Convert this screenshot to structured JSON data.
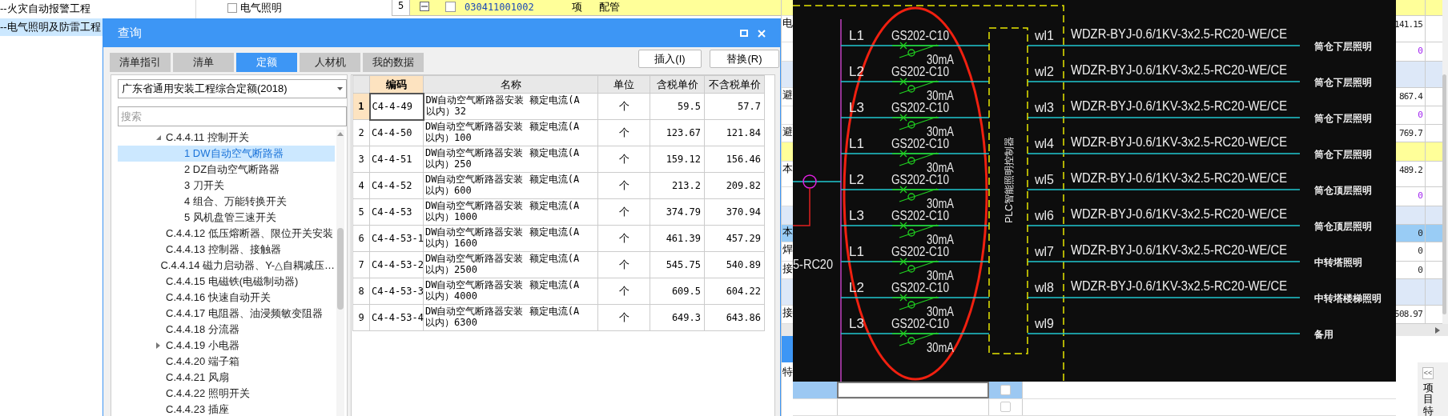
{
  "background_app": {
    "project_items": [
      {
        "label": "--火灾自动报警工程",
        "selected": false
      },
      {
        "label": "--电气照明及防雷工程",
        "selected": true
      }
    ],
    "top_checkbox": {
      "label": "电气照明",
      "checked": false
    },
    "top_row": {
      "index": "5",
      "collapsed": false,
      "checked": false,
      "code": "030411001002",
      "unit": "项",
      "name": "配管"
    },
    "rows": [
      {
        "kind": "yellow"
      },
      {
        "kind": "number",
        "edge_text": "电",
        "value": "141.15"
      },
      {
        "kind": "zero",
        "value": "0"
      },
      {
        "kind": "group"
      },
      {
        "kind": "number",
        "edge_text": "避",
        "value": "867.4"
      },
      {
        "kind": "zero",
        "value": "0"
      },
      {
        "kind": "number",
        "edge_text": "避",
        "value": "769.7"
      },
      {
        "kind": "yellow"
      },
      {
        "kind": "number",
        "edge_text": "本",
        "value": "489.2"
      },
      {
        "kind": "zero",
        "value": "0"
      },
      {
        "kind": "group"
      },
      {
        "kind": "selected",
        "edge_text": "本",
        "value": "0"
      },
      {
        "kind": "number",
        "edge_text": "焊",
        "value": "0"
      },
      {
        "kind": "number",
        "edge_text": "接",
        "value": "0"
      },
      {
        "kind": "group"
      },
      {
        "kind": "number",
        "edge_text": "接",
        "value": "508.97"
      }
    ],
    "bottom_panel": {
      "header_label": "特",
      "checkboxes": [
        {
          "checked": false
        },
        {
          "checked": false
        }
      ]
    },
    "collapse_buttons": [
      "<<"
    ],
    "side_tabs": [
      "项目特"
    ]
  },
  "dialog": {
    "title": "查询",
    "tabs": [
      {
        "label": "清单指引",
        "selected": false
      },
      {
        "label": "清单",
        "selected": false
      },
      {
        "label": "定额",
        "selected": true
      },
      {
        "label": "人材机",
        "selected": false
      },
      {
        "label": "我的数据",
        "selected": false
      }
    ],
    "buttons": [
      "插入(I)",
      "替换(R)"
    ],
    "library": "广东省通用安装工程综合定额(2018)",
    "search": {
      "placeholder": "搜索"
    },
    "tree": [
      {
        "label": "C.4.4.11 控制开关",
        "kind": "folder",
        "expanded": true,
        "selected": false,
        "children": [
          {
            "label": "1 DW自动空气断路器",
            "selected": true
          },
          {
            "label": "2 DZ自动空气断路器",
            "selected": false
          },
          {
            "label": "3 刀开关",
            "selected": false
          },
          {
            "label": "4 组合、万能转换开关",
            "selected": false
          },
          {
            "label": "5 风机盘管三速开关",
            "selected": false
          }
        ]
      },
      {
        "label": "C.4.4.12 低压熔断器、限位开关安装",
        "kind": "leaf",
        "selected": false
      },
      {
        "label": "C.4.4.13 控制器、接触器",
        "kind": "leaf",
        "selected": false
      },
      {
        "label": "C.4.4.14 磁力启动器、Y-△自耦减压…",
        "kind": "leaf",
        "selected": false
      },
      {
        "label": "C.4.4.15 电磁铁(电磁制动器)",
        "kind": "leaf",
        "selected": false
      },
      {
        "label": "C.4.4.16 快速自动开关",
        "kind": "leaf",
        "selected": false
      },
      {
        "label": "C.4.4.17 电阻器、油浸频敏变阻器",
        "kind": "leaf",
        "selected": false
      },
      {
        "label": "C.4.4.18 分流器",
        "kind": "leaf",
        "selected": false
      },
      {
        "label": "C.4.4.19 小电器",
        "kind": "folder",
        "expanded": false,
        "selected": false
      },
      {
        "label": "C.4.4.20 端子箱",
        "kind": "leaf",
        "selected": false
      },
      {
        "label": "C.4.4.21 风扇",
        "kind": "leaf",
        "selected": false
      },
      {
        "label": "C.4.4.22 照明开关",
        "kind": "leaf",
        "selected": false
      },
      {
        "label": "C.4.4.23 插座",
        "kind": "leaf",
        "selected": false
      }
    ],
    "table": {
      "columns": [
        "编码",
        "名称",
        "单位",
        "含税单价",
        "不含税单价"
      ],
      "rows": [
        {
          "index": "1",
          "code": "C4-4-49",
          "name": "DW自动空气断路器安装 额定电流(A以内）32",
          "unit": "个",
          "price_with_tax": "59.5",
          "price_without_tax": "57.7",
          "selected": true
        },
        {
          "index": "2",
          "code": "C4-4-50",
          "name": "DW自动空气断路器安装 额定电流(A以内）100",
          "unit": "个",
          "price_with_tax": "123.67",
          "price_without_tax": "121.84",
          "selected": false
        },
        {
          "index": "3",
          "code": "C4-4-51",
          "name": "DW自动空气断路器安装 额定电流(A以内）250",
          "unit": "个",
          "price_with_tax": "159.12",
          "price_without_tax": "156.46",
          "selected": false
        },
        {
          "index": "4",
          "code": "C4-4-52",
          "name": "DW自动空气断路器安装 额定电流(A以内）600",
          "unit": "个",
          "price_with_tax": "213.2",
          "price_without_tax": "209.82",
          "selected": false
        },
        {
          "index": "5",
          "code": "C4-4-53",
          "name": "DW自动空气断路器安装 额定电流(A以内）1000",
          "unit": "个",
          "price_with_tax": "374.79",
          "price_without_tax": "370.94",
          "selected": false
        },
        {
          "index": "6",
          "code": "C4-4-53-1",
          "name": "DW自动空气断路器安装 额定电流(A以内）1600",
          "unit": "个",
          "price_with_tax": "461.39",
          "price_without_tax": "457.29",
          "selected": false
        },
        {
          "index": "7",
          "code": "C4-4-53-2",
          "name": "DW自动空气断路器安装 额定电流(A以内）2500",
          "unit": "个",
          "price_with_tax": "545.75",
          "price_without_tax": "540.89",
          "selected": false
        },
        {
          "index": "8",
          "code": "C4-4-53-3",
          "name": "DW自动空气断路器安装 额定电流(A以内）4000",
          "unit": "个",
          "price_with_tax": "609.5",
          "price_without_tax": "604.22",
          "selected": false
        },
        {
          "index": "9",
          "code": "C4-4-53-4",
          "name": "DW自动空气断路器安装 额定电流(A以内）6300",
          "unit": "个",
          "price_with_tax": "649.3",
          "price_without_tax": "643.86",
          "selected": false
        }
      ]
    }
  },
  "cad_drawing": {
    "bus_label": "5-RC20",
    "controller": "PLC智能照明控制器",
    "circuits": [
      {
        "phase": "L1",
        "breaker": "GS202-C10",
        "rcd": "30mA",
        "output": "wl1",
        "cable": "WDZR-BYJ-0.6/1KV-3x2.5-RC20-WE/CE",
        "load": "筒仓下层照明"
      },
      {
        "phase": "L2",
        "breaker": "GS202-C10",
        "rcd": "30mA",
        "output": "wl2",
        "cable": "WDZR-BYJ-0.6/1KV-3x2.5-RC20-WE/CE",
        "load": "筒仓下层照明"
      },
      {
        "phase": "L3",
        "breaker": "GS202-C10",
        "rcd": "30mA",
        "output": "wl3",
        "cable": "WDZR-BYJ-0.6/1KV-3x2.5-RC20-WE/CE",
        "load": "筒仓下层照明"
      },
      {
        "phase": "L1",
        "breaker": "GS202-C10",
        "rcd": "30mA",
        "output": "wl4",
        "cable": "WDZR-BYJ-0.6/1KV-3x2.5-RC20-WE/CE",
        "load": "筒仓下层照明"
      },
      {
        "phase": "L2",
        "breaker": "GS202-C10",
        "rcd": "30mA",
        "output": "wl5",
        "cable": "WDZR-BYJ-0.6/1KV-3x2.5-RC20-WE/CE",
        "load": "筒仓顶层照明"
      },
      {
        "phase": "L3",
        "breaker": "GS202-C10",
        "rcd": "30mA",
        "output": "wl6",
        "cable": "WDZR-BYJ-0.6/1KV-3x2.5-RC20-WE/CE",
        "load": "筒仓顶层照明"
      },
      {
        "phase": "L1",
        "breaker": "GS202-C10",
        "rcd": "30mA",
        "output": "wl7",
        "cable": "WDZR-BYJ-0.6/1KV-3x2.5-RC20-WE/CE",
        "load": "中转塔照明"
      },
      {
        "phase": "L2",
        "breaker": "GS202-C10",
        "rcd": "30mA",
        "output": "wl8",
        "cable": "WDZR-BYJ-0.6/1KV-3x2.5-RC20-WE/CE",
        "load": "中转塔楼梯照明"
      },
      {
        "phase": "L3",
        "breaker": "GS202-C10",
        "rcd": "30mA",
        "output": "wl9",
        "load": "备用"
      }
    ]
  }
}
